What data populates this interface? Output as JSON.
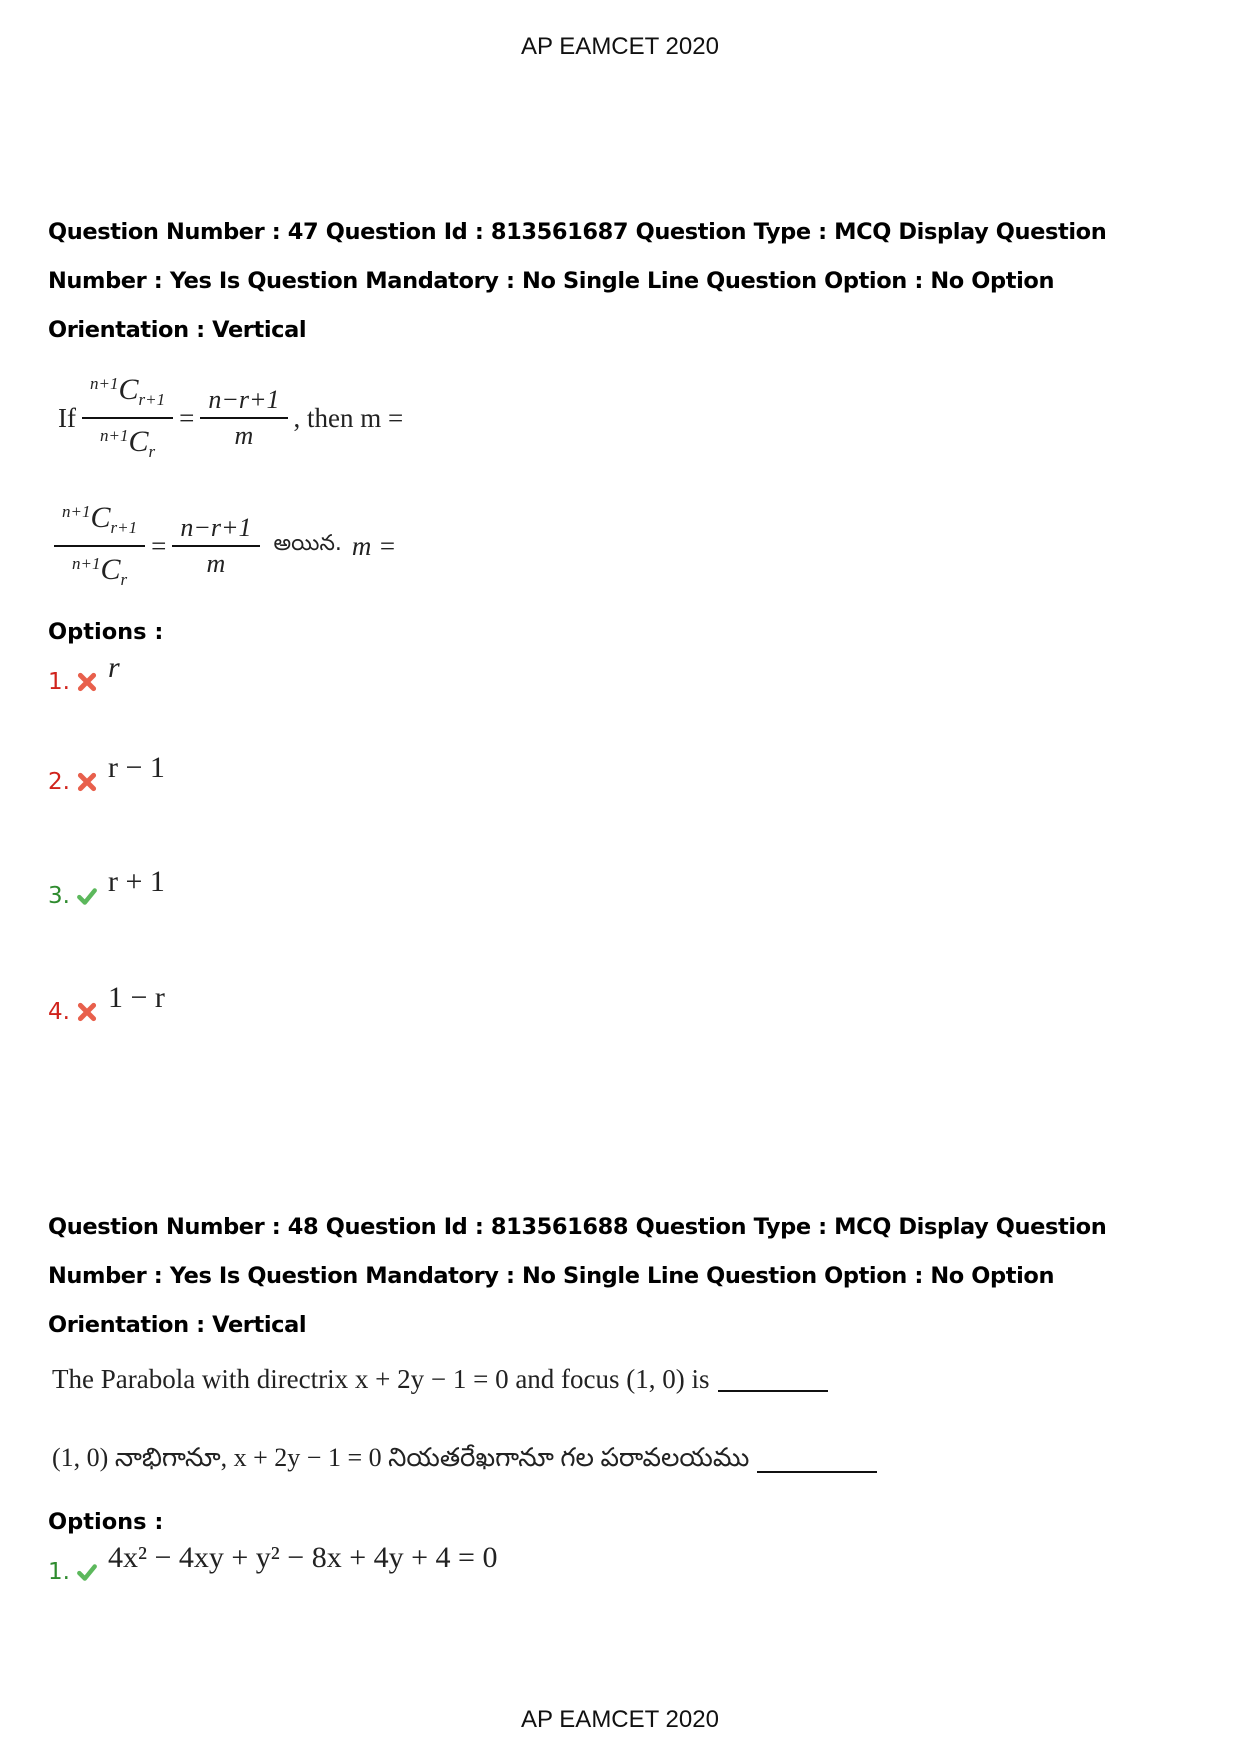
{
  "header": {
    "title": "AP EAMCET 2020"
  },
  "footer": {
    "title": "AP EAMCET 2020"
  },
  "colors": {
    "wrong": "#d0231c",
    "correct": "#2e8b2e",
    "wrong_icon": "#e8604c",
    "correct_icon": "#5cb85c"
  },
  "questions": [
    {
      "meta_lines": [
        "Question Number : 47 Question Id : 813561687 Question Type : MCQ Display Question",
        "Number : Yes Is Question Mandatory : No Single Line Question Option : No Option",
        "Orientation : Vertical"
      ],
      "stem_en": {
        "prefix": "If",
        "frac1_num_sup": "n+1",
        "frac1_num_base": "C",
        "frac1_num_sub": "r+1",
        "frac1_den_sup": "n+1",
        "frac1_den_base": "C",
        "frac1_den_sub": "r",
        "equals": "=",
        "frac2_num": "n−r+1",
        "frac2_den": "m",
        "suffix": ", then m ="
      },
      "stem_te": {
        "telugu_word": "అయిన.",
        "suffix": "m ="
      },
      "options_label": "Options :",
      "options": [
        {
          "number": "1.",
          "status": "wrong",
          "icon": "cross-icon",
          "text": "r"
        },
        {
          "number": "2.",
          "status": "wrong",
          "icon": "cross-icon",
          "text": "r − 1"
        },
        {
          "number": "3.",
          "status": "correct",
          "icon": "check-icon",
          "text": "r + 1"
        },
        {
          "number": "4.",
          "status": "wrong",
          "icon": "cross-icon",
          "text": "1 − r"
        }
      ]
    },
    {
      "meta_lines": [
        "Question Number : 48 Question Id : 813561688 Question Type : MCQ Display Question",
        "Number : Yes Is Question Mandatory : No Single Line Question Option : No Option",
        "Orientation : Vertical"
      ],
      "stem_en": "The Parabola with directrix x + 2y − 1 = 0 and focus (1, 0) is",
      "stem_te": "(1, 0) నాభిగానూ, x + 2y − 1 = 0 నియతరేఖగానూ గల పరావలయము",
      "options_label": "Options :",
      "options": [
        {
          "number": "1.",
          "status": "correct",
          "icon": "check-icon",
          "text": "4x² − 4xy + y² − 8x + 4y + 4 = 0"
        }
      ]
    }
  ]
}
